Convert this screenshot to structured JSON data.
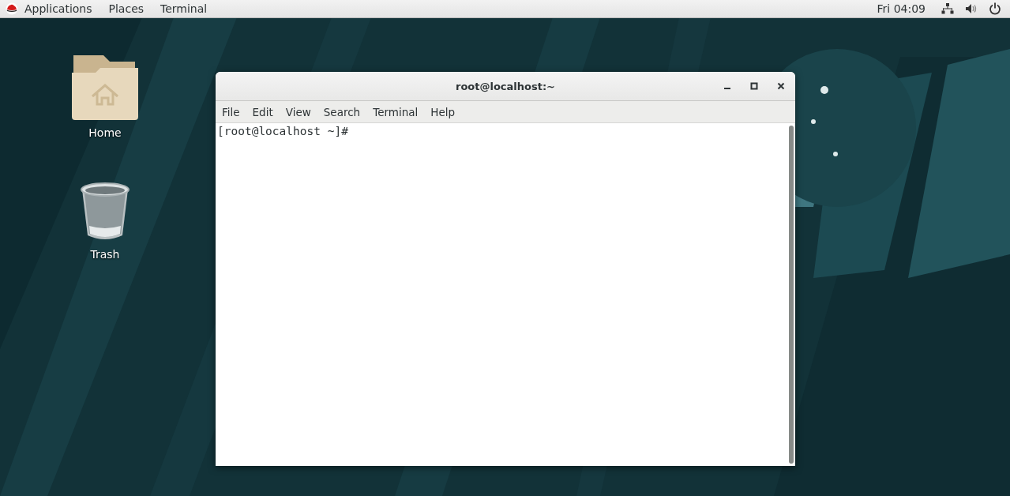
{
  "top_bar": {
    "menus": [
      "Applications",
      "Places",
      "Terminal"
    ],
    "clock": "Fri 04:09"
  },
  "desktop_icons": [
    {
      "label": "Home",
      "kind": "folder"
    },
    {
      "label": "Trash",
      "kind": "trash"
    }
  ],
  "terminal": {
    "title": "root@localhost:~",
    "menu": [
      "File",
      "Edit",
      "View",
      "Search",
      "Terminal",
      "Help"
    ],
    "lines": [
      "[root@localhost ~]#"
    ]
  }
}
